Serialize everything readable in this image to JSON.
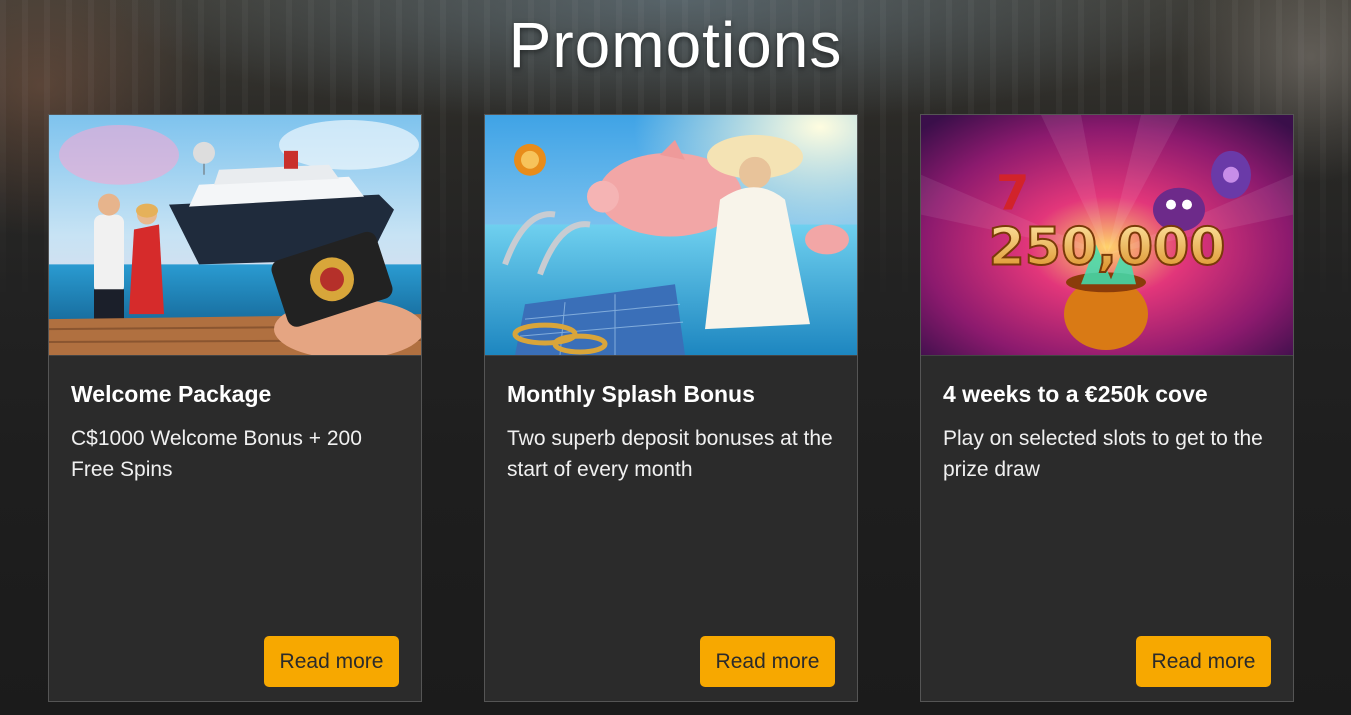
{
  "page": {
    "title": "Promotions"
  },
  "colors": {
    "accent": "#f7a800",
    "card_bg": "#2b2b2b",
    "page_bg": "#1d1d1d"
  },
  "promotions": [
    {
      "title": "Welcome Package",
      "description": "C$1000 Welcome Bonus + 200 Free Spins",
      "button_label": "Read more",
      "image_icon": "cruise-ship-welcome-image"
    },
    {
      "title": "Monthly Splash Bonus",
      "description": "Two superb deposit bonuses at the start of every month",
      "button_label": "Read more",
      "image_icon": "piggy-bank-pool-image"
    },
    {
      "title": "4 weeks to a €250k cove",
      "description": "Play on selected slots to get to the prize draw",
      "button_label": "Read more",
      "image_icon": "jackpot-pot-image",
      "image_text": "250,000"
    }
  ]
}
